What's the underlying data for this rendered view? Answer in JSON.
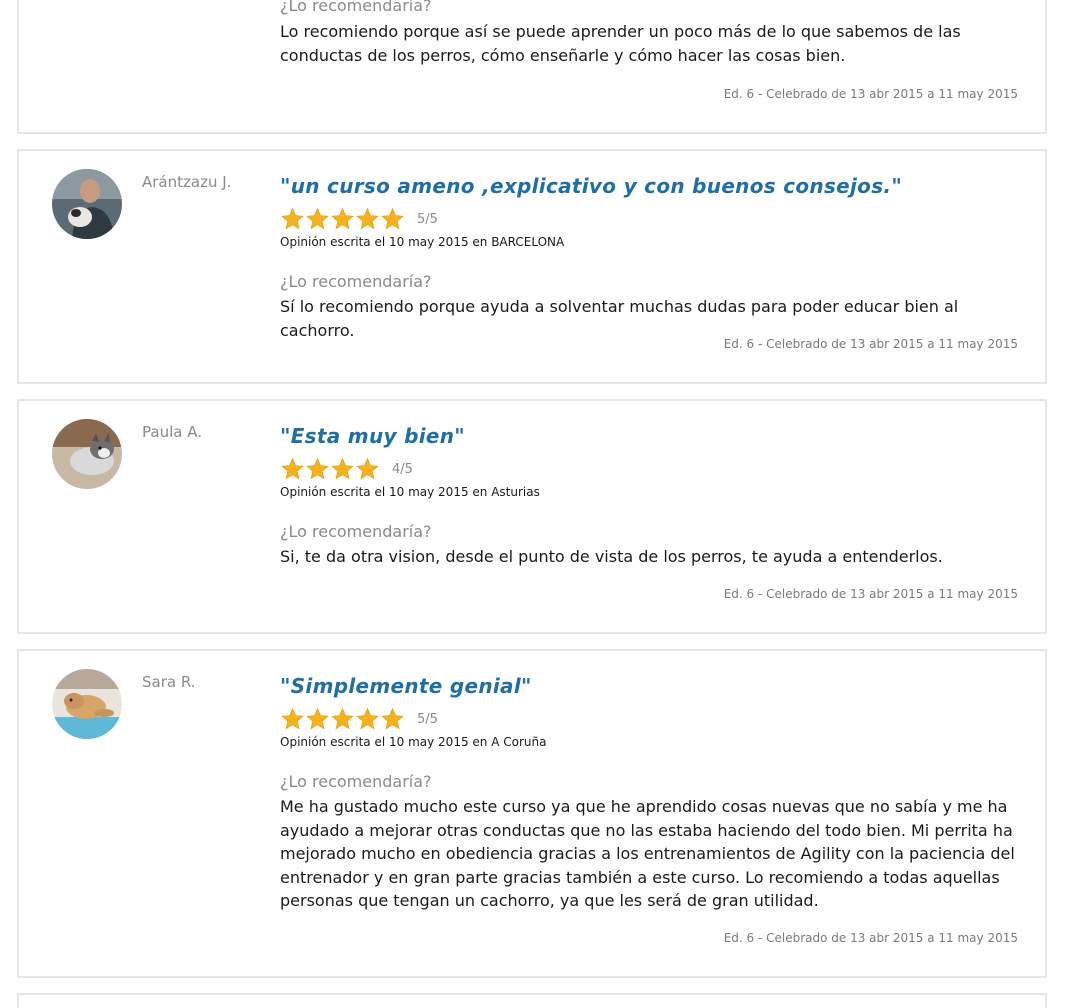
{
  "question_label": "¿Lo recomendaría?",
  "reviews": [
    {
      "author": "",
      "title": "",
      "rating_text": "",
      "meta": "",
      "answer": "Lo recomiendo porque así se puede aprender un poco más de lo que sabemos de las conductas de los perros, cómo enseñarle y cómo hacer las cosas bien.",
      "edition": "Ed. 6 - Celebrado de 13 abr 2015 a 11 may 2015"
    },
    {
      "author": "Arántzazu J.",
      "title": "\"un curso ameno ,explicativo y con buenos consejos.\"",
      "rating": 5,
      "rating_text": "5/5",
      "meta": "Opinión escrita el 10 may 2015 en BARCELONA",
      "answer": "Sí lo recomiendo porque ayuda a solventar muchas dudas para poder educar bien al cachorro.",
      "edition": "Ed. 6 - Celebrado de 13 abr 2015 a 11 may 2015"
    },
    {
      "author": "Paula A.",
      "title": "\"Esta muy bien\"",
      "rating": 4,
      "rating_text": "4/5",
      "meta": "Opinión escrita el 10 may 2015 en Asturias",
      "answer": "Si, te da otra vision, desde el punto de vista de los perros, te ayuda a entenderlos.",
      "edition": "Ed. 6 - Celebrado de 13 abr 2015 a 11 may 2015"
    },
    {
      "author": "Sara R.",
      "title": "\"Simplemente genial\"",
      "rating": 5,
      "rating_text": "5/5",
      "meta": "Opinión escrita el 10 may 2015 en A Coruña",
      "answer": "Me ha gustado mucho este curso ya que he aprendido cosas nuevas que no sabía y me ha ayudado a mejorar otras conductas que no las estaba haciendo del todo bien. Mi perrita ha mejorado mucho en obediencia gracias a los entrenamientos de Agility con la paciencia del entrenador y en gran parte gracias también a este curso. Lo recomiendo a todas aquellas personas que tengan un cachorro, ya que les será de gran utilidad.",
      "edition": "Ed. 6 - Celebrado de 13 abr 2015 a 11 may 2015"
    }
  ],
  "colors": {
    "title": "#1f6fa6",
    "star": "#f5b21a",
    "border": "#e6e6e6",
    "muted": "#8a8a8a"
  }
}
